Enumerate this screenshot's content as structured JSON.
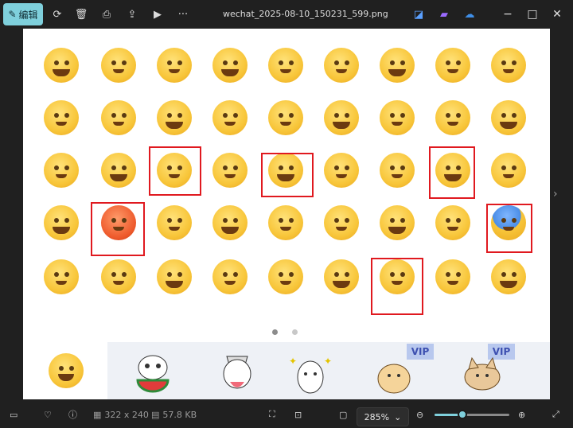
{
  "toolbar": {
    "edit_label": "编辑",
    "title": "wechat_2025-08-10_150231_599.png",
    "more_label": "···"
  },
  "canvas": {
    "vip_label": "VIP",
    "page_dots": 2,
    "active_page": 1
  },
  "statusbar": {
    "dimensions": "322 x 240",
    "file_size": "57.8 KB",
    "zoom": "285%",
    "zoom_level": 0.37
  },
  "colors": {
    "accent": "#7fd0dc",
    "selection": "#e0191f"
  }
}
